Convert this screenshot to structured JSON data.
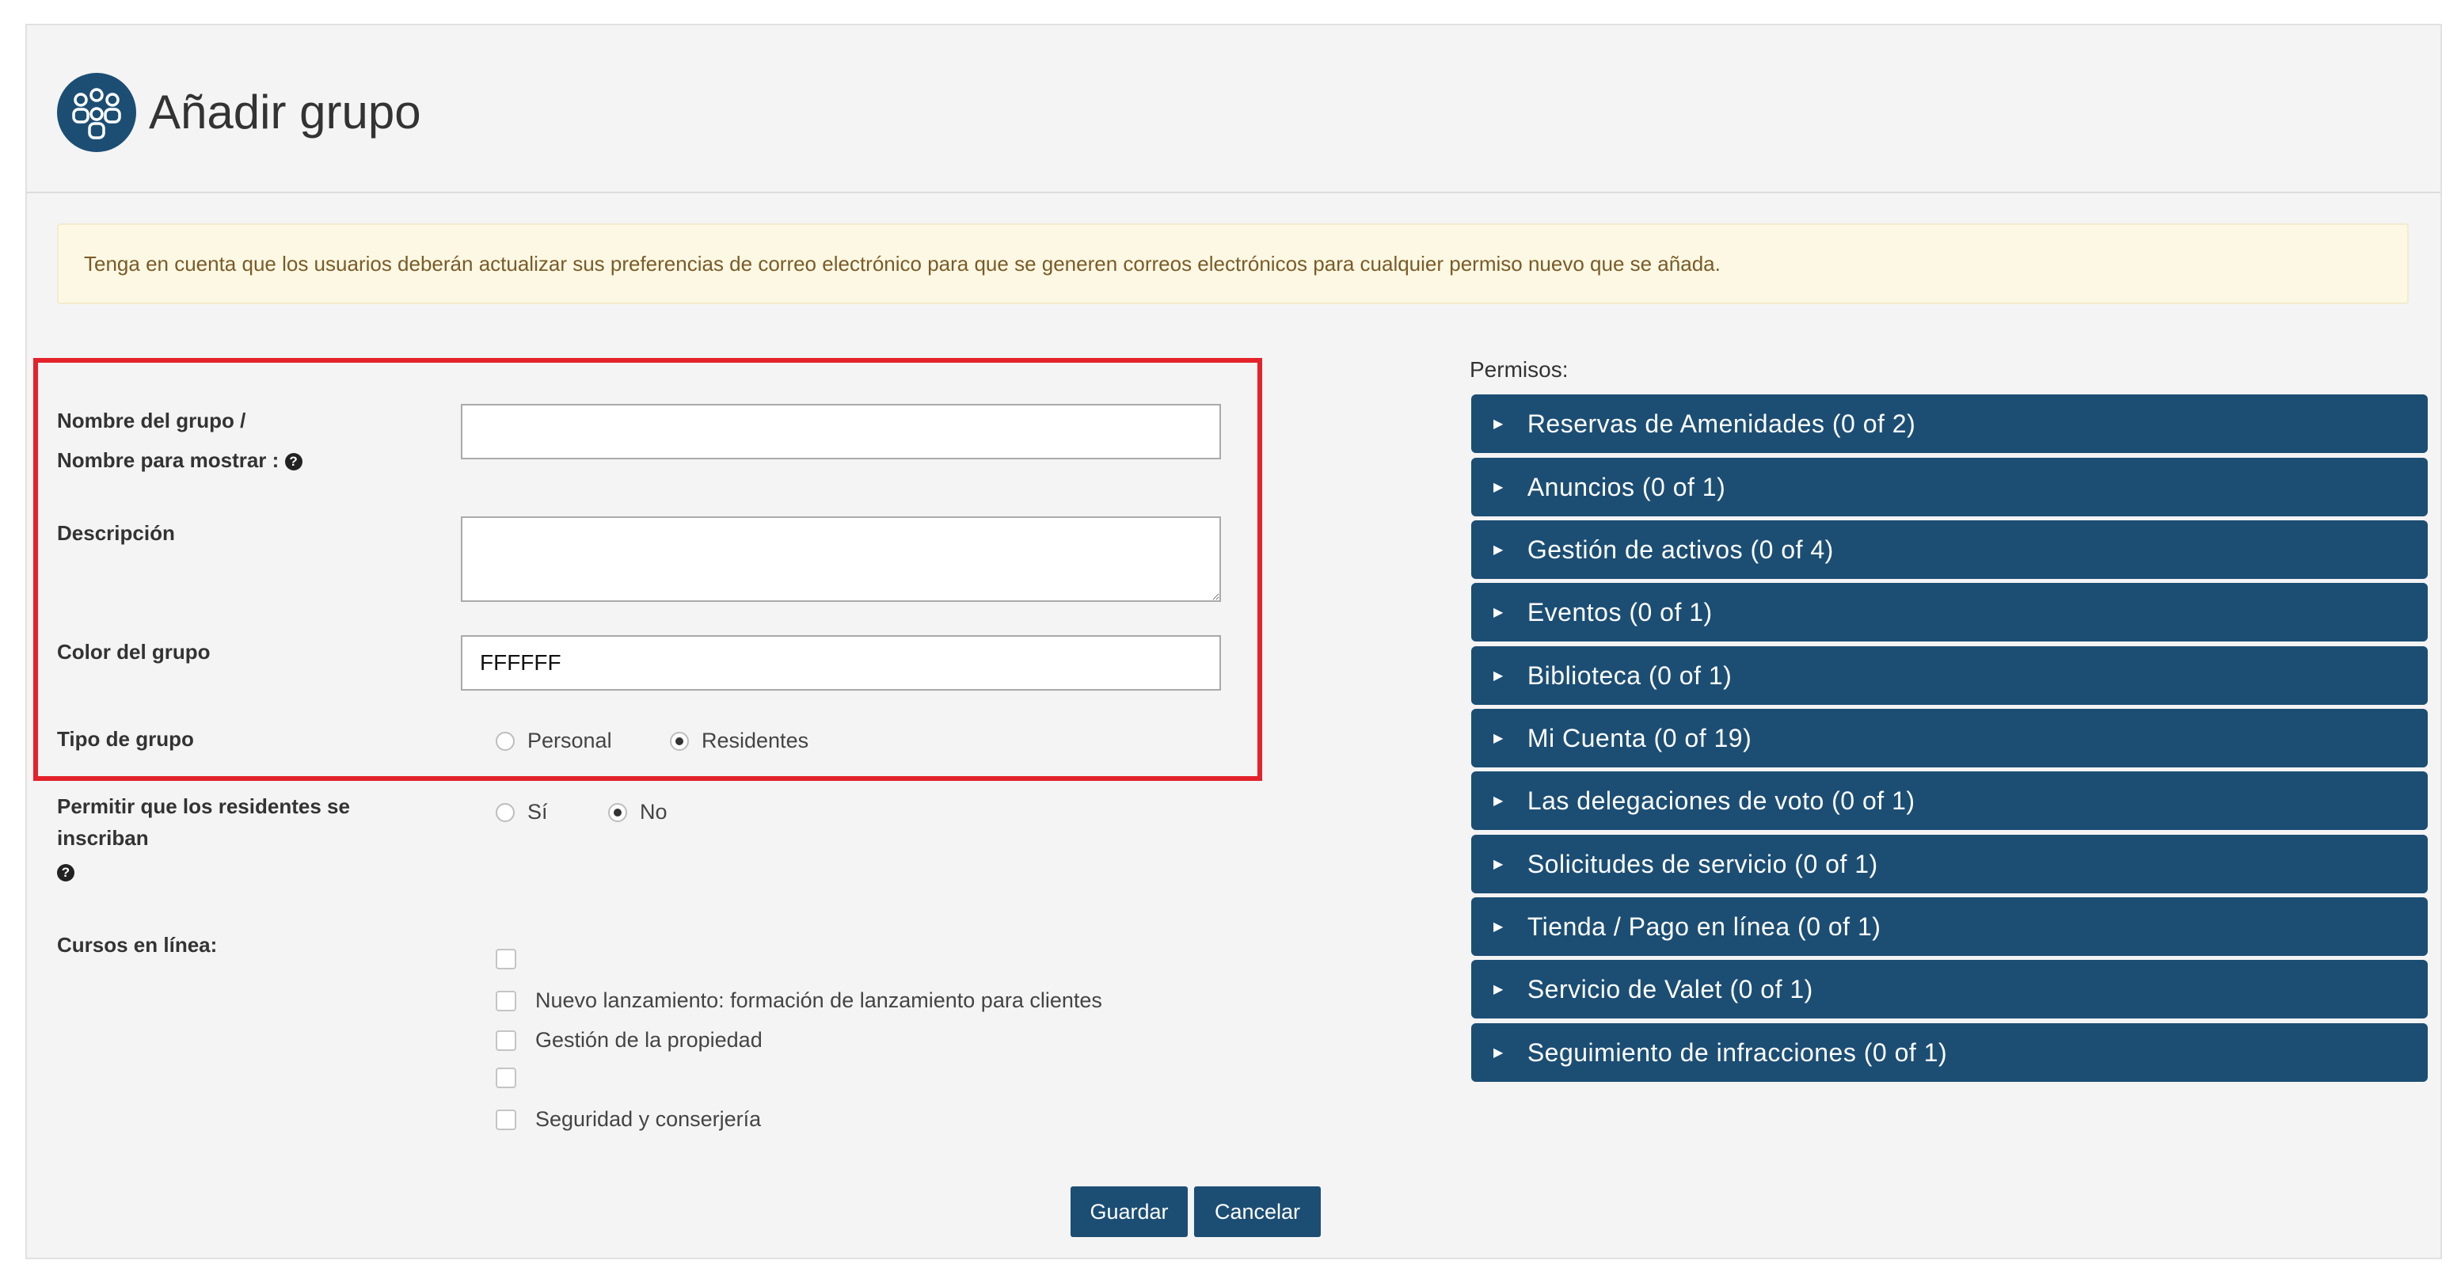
{
  "header": {
    "title": "Añadir grupo",
    "icon": "group-icon"
  },
  "alert": {
    "text": "Tenga en cuenta que los usuarios deberán actualizar sus preferencias de correo electrónico para que se generen correos electrónicos para cualquier permiso nuevo que se añada."
  },
  "form": {
    "group_name_label_1": "Nombre del grupo /",
    "group_name_label_2": "Nombre para mostrar :",
    "group_name_value": "",
    "description_label": "Descripción",
    "description_value": "",
    "color_label": "Color del grupo",
    "color_value": "FFFFFF",
    "type_label": "Tipo de grupo",
    "type_options": [
      "Personal",
      "Residentes"
    ],
    "type_selected": "Residentes",
    "allow_label_1": "Permitir que los residentes se",
    "allow_label_2": "inscriban",
    "allow_options": [
      "Sí",
      "No"
    ],
    "allow_selected": "No",
    "courses_label": "Cursos en línea:",
    "courses": [
      "",
      "Nuevo lanzamiento: formación de lanzamiento para clientes",
      "Gestión de la propiedad",
      "",
      "Seguridad y conserjería"
    ]
  },
  "permissions": {
    "label": "Permisos:",
    "items": [
      "Reservas de Amenidades (0 of 2)",
      "Anuncios (0 of 1)",
      "Gestión de activos (0 of 4)",
      "Eventos (0 of 1)",
      "Biblioteca (0 of 1)",
      "Mi Cuenta (0 of 19)",
      "Las delegaciones de voto (0 of 1)",
      "Solicitudes de servicio (0 of 1)",
      "Tienda / Pago en línea (0 of 1)",
      "Servicio de Valet (0 of 1)",
      "Seguimiento de infracciones (0 of 1)"
    ]
  },
  "buttons": {
    "save": "Guardar",
    "cancel": "Cancelar"
  },
  "colors": {
    "primary": "#1c4e74",
    "alert_bg": "#fcf8e3",
    "highlight": "#e3222b"
  }
}
